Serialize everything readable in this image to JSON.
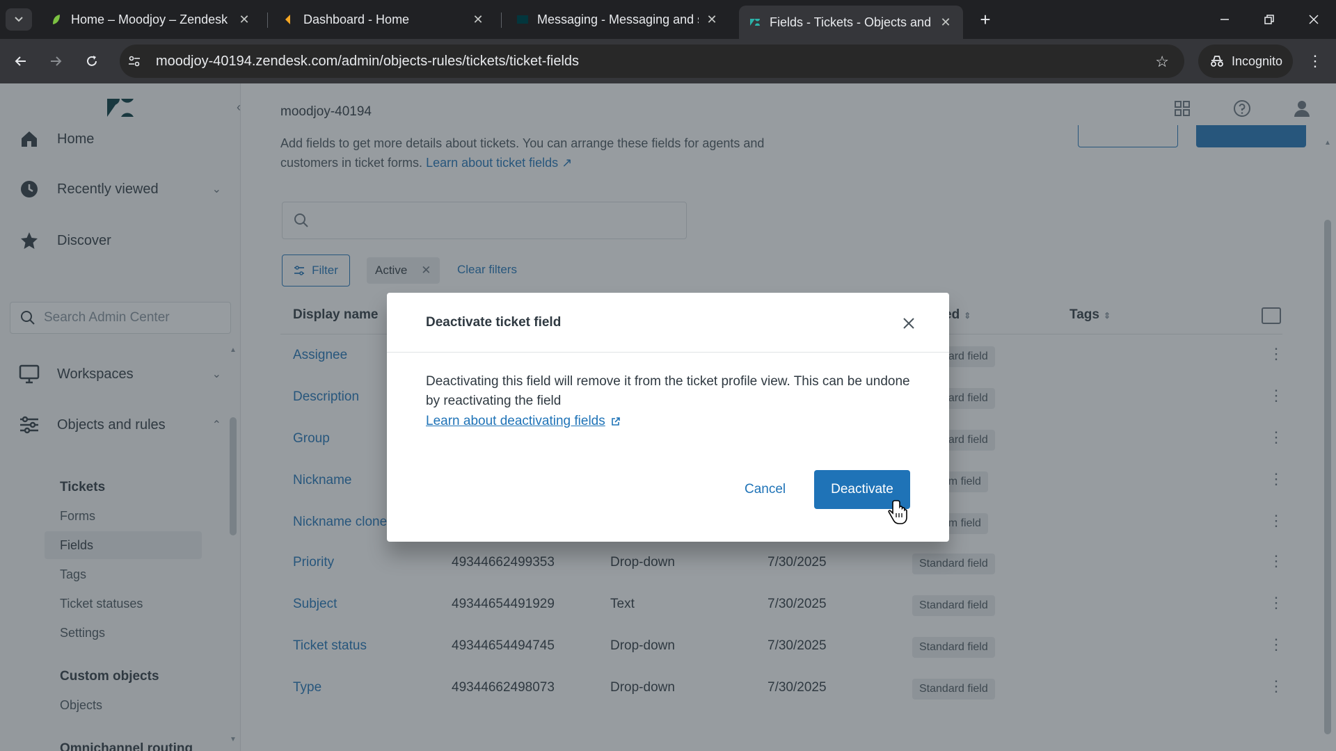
{
  "browser": {
    "tabs": [
      {
        "title": "Home – Moodjoy – Zendesk",
        "favicon_color": "#7cc242"
      },
      {
        "title": "Dashboard - Home",
        "favicon_color": "#f5a623"
      },
      {
        "title": "Messaging - Messaging and so",
        "favicon_color": "#03363d"
      },
      {
        "title": "Fields - Tickets - Objects and ru",
        "favicon_color": "#03363d"
      }
    ],
    "url": "moodjoy-40194.zendesk.com/admin/objects-rules/tickets/ticket-fields",
    "incognito_label": "Incognito"
  },
  "sidebar": {
    "nav": [
      {
        "label": "Home",
        "icon": "home-icon"
      },
      {
        "label": "Recently viewed",
        "icon": "clock-icon"
      },
      {
        "label": "Discover",
        "icon": "star-icon"
      }
    ],
    "search_placeholder": "Search Admin Center",
    "sections": [
      {
        "label": "Workspaces",
        "icon": "monitor-icon"
      },
      {
        "label": "Objects and rules",
        "icon": "sliders-icon"
      }
    ],
    "tickets_heading": "Tickets",
    "tickets_items": [
      "Forms",
      "Fields",
      "Tags",
      "Ticket statuses",
      "Settings"
    ],
    "active_item": "Fields",
    "custom_objects_heading": "Custom objects",
    "custom_objects_items": [
      "Objects"
    ],
    "next_heading": "Omnichannel routing"
  },
  "main": {
    "account_name": "moodjoy-40194",
    "description": "Add fields to get more details about tickets. You can arrange these fields for agents and customers in ticket forms.",
    "description_link": "Learn about ticket fields",
    "filter_label": "Filter",
    "active_chip": "Active",
    "clear_filters": "Clear filters",
    "headers": {
      "display_name": "Display name",
      "updated_partial": "ed",
      "tags": "Tags"
    },
    "rows": [
      {
        "name": "Assignee",
        "id": "",
        "type": "",
        "date": "",
        "tag": "Standard field"
      },
      {
        "name": "Description",
        "id": "",
        "type": "",
        "date": "",
        "tag": "Standard field"
      },
      {
        "name": "Group",
        "id": "",
        "type": "",
        "date": "",
        "tag": "Standard field"
      },
      {
        "name": "Nickname",
        "id": "",
        "type": "",
        "date": "",
        "tag": "Custom field"
      },
      {
        "name": "Nickname clone",
        "id": "",
        "type": "",
        "date": "",
        "tag": "Custom field"
      },
      {
        "name": "Priority",
        "id": "49344662499353",
        "type": "Drop-down",
        "date": "7/30/2025",
        "tag": "Standard field"
      },
      {
        "name": "Subject",
        "id": "49344654491929",
        "type": "Text",
        "date": "7/30/2025",
        "tag": "Standard field"
      },
      {
        "name": "Ticket status",
        "id": "49344654494745",
        "type": "Drop-down",
        "date": "7/30/2025",
        "tag": "Standard field"
      },
      {
        "name": "Type",
        "id": "49344662498073",
        "type": "Drop-down",
        "date": "7/30/2025",
        "tag": "Standard field"
      }
    ]
  },
  "modal": {
    "title": "Deactivate ticket field",
    "body": "Deactivating this field will remove it from the ticket profile view. This can be undone by reactivating the field",
    "link": "Learn about deactivating fields",
    "cancel_label": "Cancel",
    "confirm_label": "Deactivate"
  }
}
